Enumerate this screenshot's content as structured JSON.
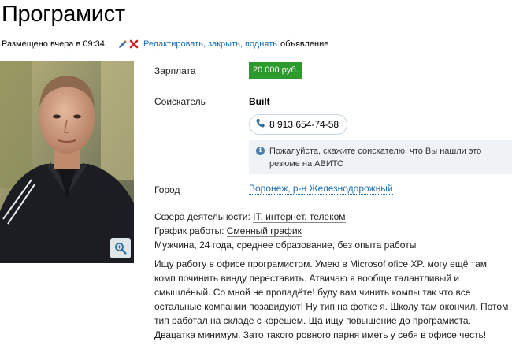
{
  "page": {
    "title": "Програмист"
  },
  "meta": {
    "posted": "Размещено вчера в 09:34.",
    "actions": [
      {
        "label": "Редактировать,"
      },
      {
        "label": "закрыть,"
      },
      {
        "label": "поднять"
      }
    ],
    "tail": "объявление"
  },
  "fields": {
    "salary_label": "Зарплата",
    "salary_value": "20 000 руб.",
    "seeker_label": "Соискатель",
    "seeker_name": "Built",
    "phone": "8 913 654-74-58",
    "notice": "Пожалуйста, скажите соискателю, что Вы нашли это резюме на АВИТО",
    "city_label": "Город",
    "city_value": "Воронеж, р-н Железнодорожный"
  },
  "details": {
    "sphere_label": "Сфера деятельности:",
    "sphere_value": "IT, интернет, телеком",
    "schedule_label": "График работы:",
    "schedule_value": "Сменный график",
    "profile": [
      {
        "text": "Мужчина, 24 года"
      },
      {
        "text": "среднее образование"
      },
      {
        "text": "без опыта работы"
      }
    ]
  },
  "description": "Ищу работу в офисе програмистом. Умею в Microsof ofice XP. могу ещё там комп починить винду переставить. Атвичаю я вообще талантливый и смышлёный. Со мной не пропадёте! буду вам чинить компы так что все остальные компании позавидуют! Ну тип на фотке я. Школу там окончил. Потом тип работал на складе с корешем. Ща ищу повышение до програмиста. Двацатка минимум. Зато такого ровного парня иметь у себя в офисе честь!",
  "icons": {
    "edit": "pencil-icon",
    "delete": "close-icon",
    "phone": "phone-icon",
    "info": "info-icon",
    "zoom": "zoom-icon"
  },
  "colors": {
    "link": "#1a6fb5",
    "salary_bg": "#2c9a2c",
    "notice_bg": "#f0f3f5",
    "delete": "#d42020"
  }
}
